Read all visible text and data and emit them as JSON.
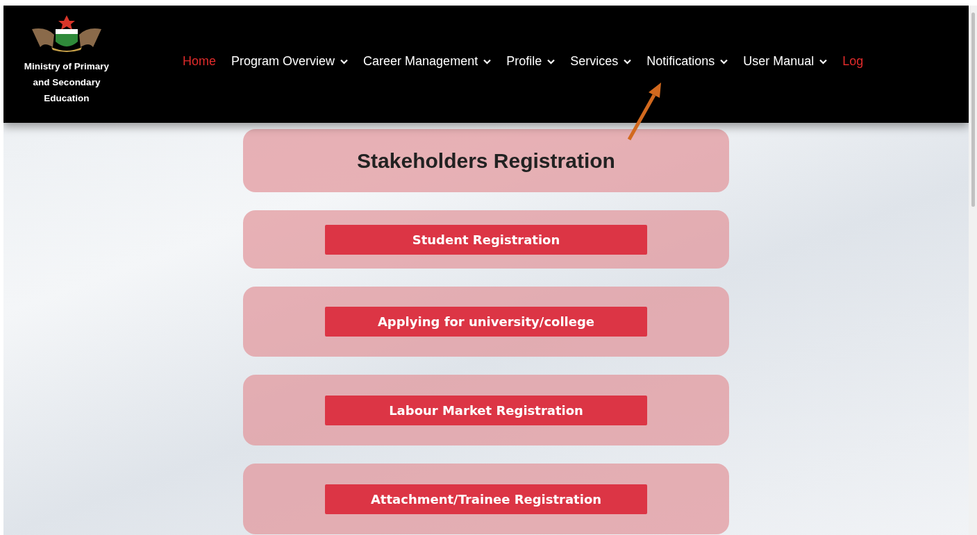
{
  "header": {
    "logo_caption": "Ministry of Primary and Secondary Education",
    "nav": [
      {
        "label": "Home",
        "color": "#e02b2b",
        "dropdown": false
      },
      {
        "label": "Program Overview",
        "color": "#ffffff",
        "dropdown": true
      },
      {
        "label": "Career Management",
        "color": "#ffffff",
        "dropdown": true
      },
      {
        "label": "Profile",
        "color": "#ffffff",
        "dropdown": true
      },
      {
        "label": "Services",
        "color": "#ffffff",
        "dropdown": true
      },
      {
        "label": "Notifications",
        "color": "#ffffff",
        "dropdown": true
      },
      {
        "label": "User Manual",
        "color": "#ffffff",
        "dropdown": true
      },
      {
        "label": "Log",
        "color": "#e02b2b",
        "dropdown": false
      }
    ]
  },
  "title": "Stakeholders Registration",
  "registrations": [
    {
      "label": "Student Registration"
    },
    {
      "label": "Applying for university/college"
    },
    {
      "label": "Labour Market Registration"
    },
    {
      "label": "Attachment/Trainee Registration"
    }
  ]
}
